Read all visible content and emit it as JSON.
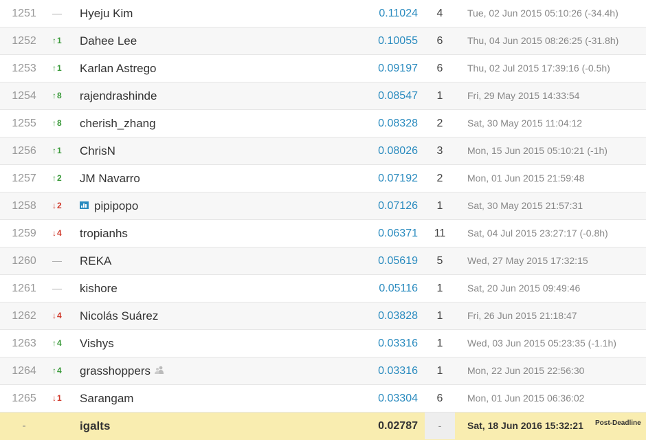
{
  "leaderboard": {
    "rows": [
      {
        "rank": "1251",
        "delta": "—",
        "dir": "none",
        "team": "Hyeju Kim",
        "score": "0.11024",
        "entries": "4",
        "last": "Tue, 02 Jun 2015 05:10:26 (-34.4h)"
      },
      {
        "rank": "1252",
        "delta": "1",
        "dir": "up",
        "team": "Dahee Lee",
        "score": "0.10055",
        "entries": "6",
        "last": "Thu, 04 Jun 2015 08:26:25 (-31.8h)"
      },
      {
        "rank": "1253",
        "delta": "1",
        "dir": "up",
        "team": "Karlan Astrego",
        "score": "0.09197",
        "entries": "6",
        "last": "Thu, 02 Jul 2015 17:39:16 (-0.5h)"
      },
      {
        "rank": "1254",
        "delta": "8",
        "dir": "up",
        "team": "rajendrashinde",
        "score": "0.08547",
        "entries": "1",
        "last": "Fri, 29 May 2015 14:33:54"
      },
      {
        "rank": "1255",
        "delta": "8",
        "dir": "up",
        "team": "cherish_zhang",
        "score": "0.08328",
        "entries": "2",
        "last": "Sat, 30 May 2015 11:04:12"
      },
      {
        "rank": "1256",
        "delta": "1",
        "dir": "up",
        "team": "ChrisN",
        "score": "0.08026",
        "entries": "3",
        "last": "Mon, 15 Jun 2015 05:10:21 (-1h)"
      },
      {
        "rank": "1257",
        "delta": "2",
        "dir": "up",
        "team": "JM Navarro",
        "score": "0.07192",
        "entries": "2",
        "last": "Mon, 01 Jun 2015 21:59:48"
      },
      {
        "rank": "1258",
        "delta": "2",
        "dir": "down",
        "team": "pipipopo",
        "score": "0.07126",
        "entries": "1",
        "last": "Sat, 30 May 2015 21:57:31",
        "icon": "chart-icon"
      },
      {
        "rank": "1259",
        "delta": "4",
        "dir": "down",
        "team": "tropianhs",
        "score": "0.06371",
        "entries": "11",
        "last": "Sat, 04 Jul 2015 23:27:17 (-0.8h)"
      },
      {
        "rank": "1260",
        "delta": "—",
        "dir": "none",
        "team": "REKA",
        "score": "0.05619",
        "entries": "5",
        "last": "Wed, 27 May 2015 17:32:15"
      },
      {
        "rank": "1261",
        "delta": "—",
        "dir": "none",
        "team": "kishore",
        "score": "0.05116",
        "entries": "1",
        "last": "Sat, 20 Jun 2015 09:49:46"
      },
      {
        "rank": "1262",
        "delta": "4",
        "dir": "down",
        "team": "Nicolás Suárez",
        "score": "0.03828",
        "entries": "1",
        "last": "Fri, 26 Jun 2015 21:18:47"
      },
      {
        "rank": "1263",
        "delta": "4",
        "dir": "up",
        "team": "Vishys",
        "score": "0.03316",
        "entries": "1",
        "last": "Wed, 03 Jun 2015 05:23:35 (-1.1h)"
      },
      {
        "rank": "1264",
        "delta": "4",
        "dir": "up",
        "team": "grasshoppers",
        "score": "0.03316",
        "entries": "1",
        "last": "Mon, 22 Jun 2015 22:56:30",
        "icon": "team-icon"
      },
      {
        "rank": "1265",
        "delta": "1",
        "dir": "down",
        "team": "Sarangam",
        "score": "0.03304",
        "entries": "6",
        "last": "Mon, 01 Jun 2015 06:36:02"
      }
    ],
    "my_row": {
      "rank": "-",
      "team": "igalts",
      "score": "0.02787",
      "entries": "-",
      "last": "Sat, 18 Jun 2016 15:32:21",
      "tag": "Post-Deadline"
    }
  },
  "colors": {
    "up": "#3a9a3a",
    "down": "#d0392b",
    "score": "#2a8bbf",
    "highlight": "#f9edb0"
  }
}
